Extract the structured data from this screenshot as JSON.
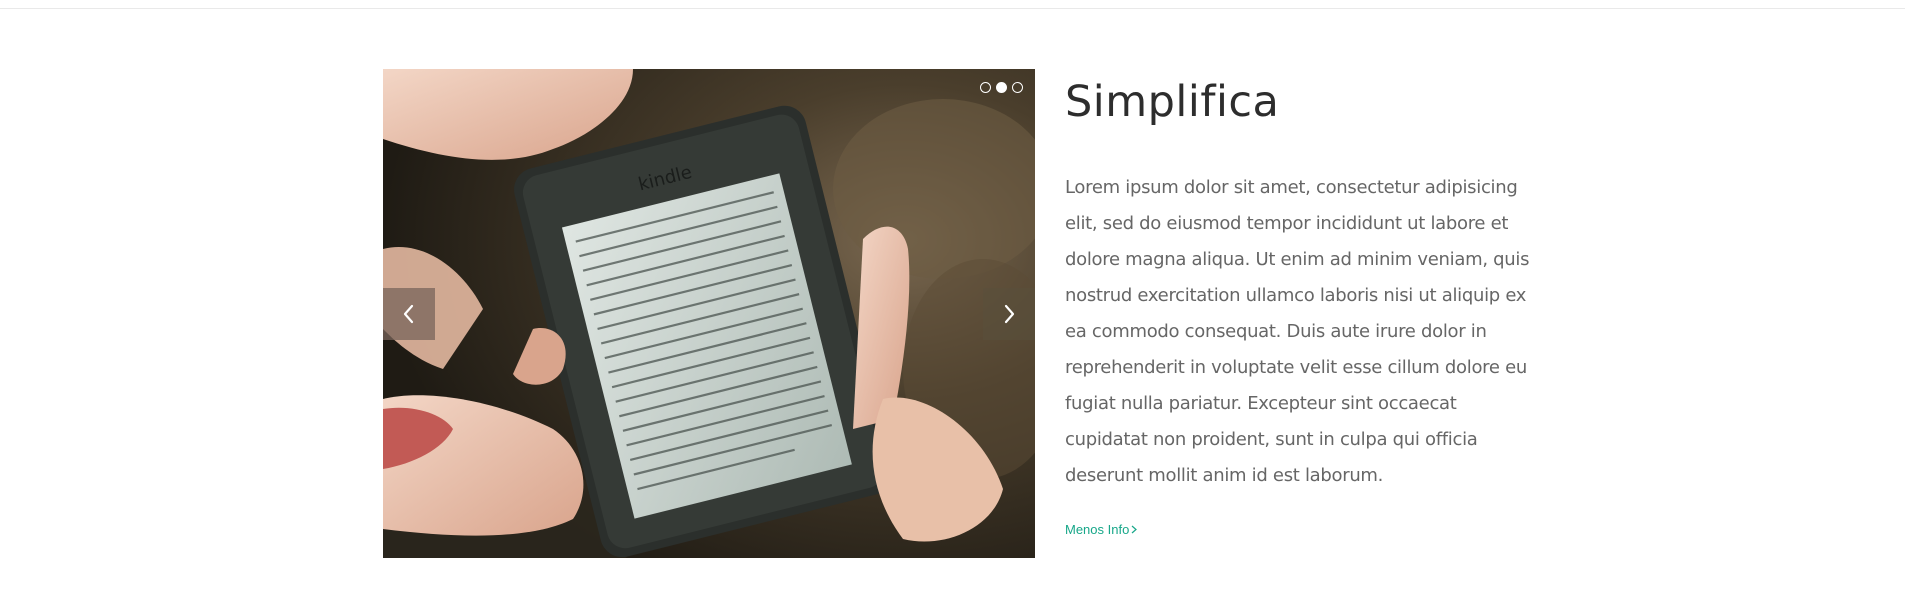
{
  "slider": {
    "image_alt": "Hand holding a Kindle e-reader",
    "device_brand": "kindle",
    "dots": [
      {
        "icon": "dot-icon",
        "active": false
      },
      {
        "icon": "dot-icon",
        "active": true
      },
      {
        "icon": "dot-icon",
        "active": false
      }
    ],
    "prev_icon": "chevron-left-icon",
    "next_icon": "chevron-right-icon"
  },
  "feature": {
    "title": "Simplifica",
    "description": "Lorem ipsum dolor sit amet, consectetur adipisicing elit, sed do eiusmod tempor incididunt ut labore et dolore magna aliqua. Ut enim ad minim veniam, quis nostrud exercitation ullamco laboris nisi ut aliquip ex ea commodo consequat. Duis aute irure dolor in reprehenderit in voluptate velit esse cillum dolore eu fugiat nulla pariatur. Excepteur sint occaecat cupidatat non proident, sunt in culpa qui officia deserunt mollit anim id est laborum.",
    "link_label": "Menos Info",
    "link_icon": "chevron-right-icon"
  },
  "colors": {
    "accent": "#17a789",
    "title": "#2d2d2d",
    "body_text": "#666666"
  }
}
